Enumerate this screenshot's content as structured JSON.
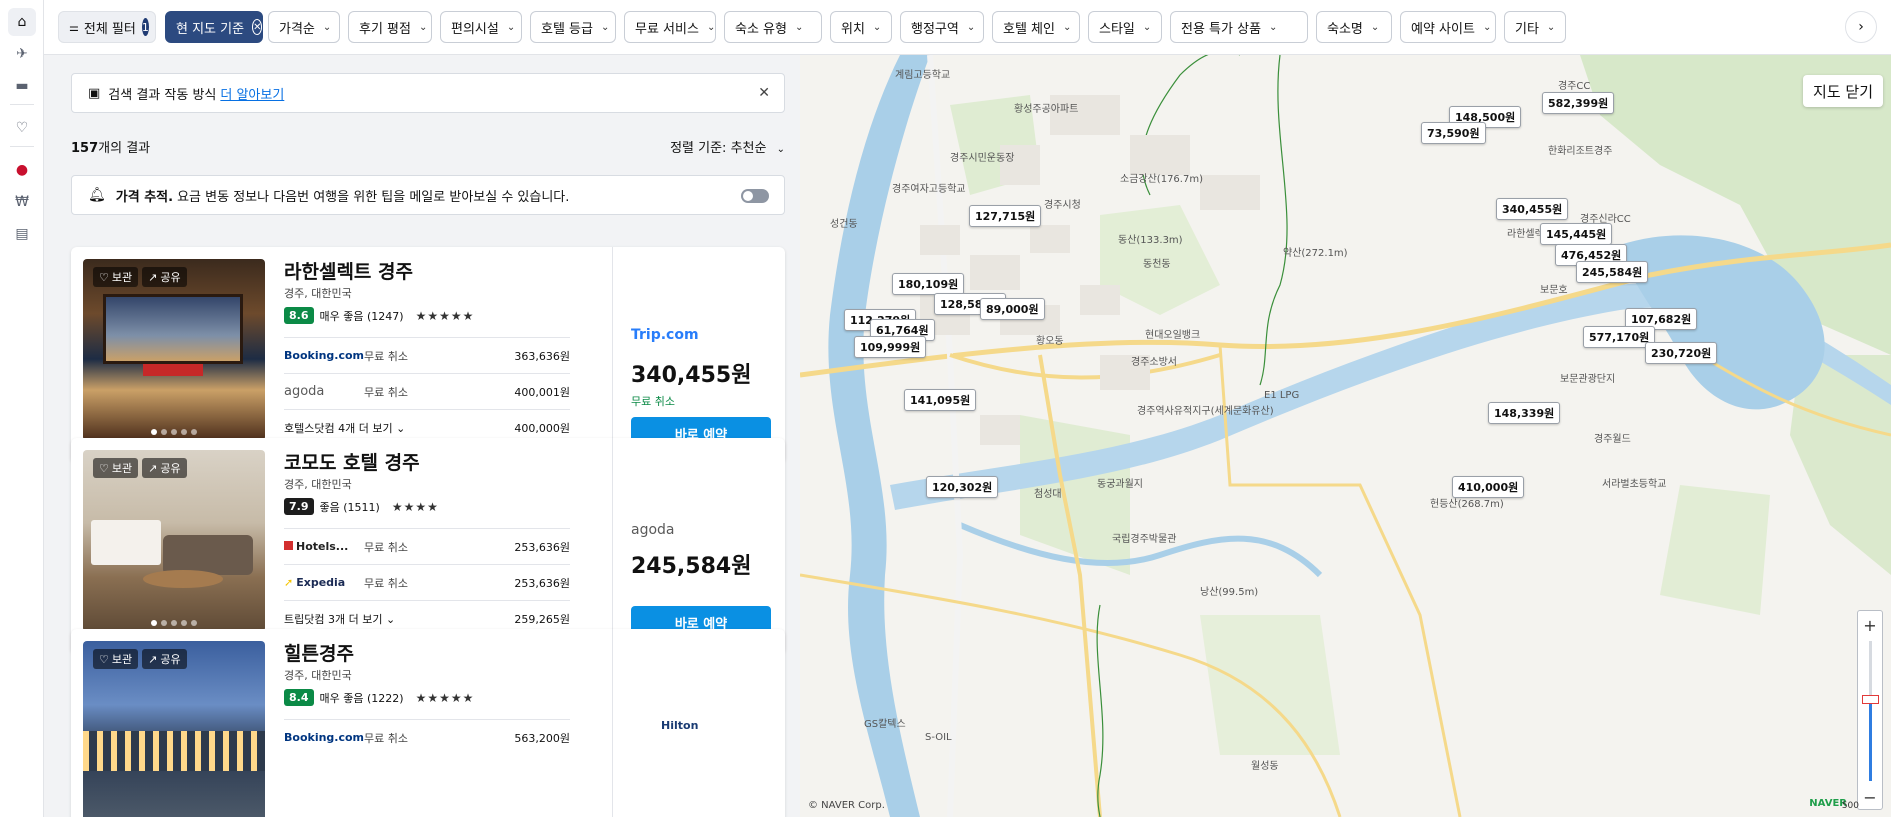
{
  "rail": {
    "items": [
      {
        "icon": "bed-icon",
        "glyph": "⌂"
      },
      {
        "icon": "plane-icon",
        "glyph": "✈"
      },
      {
        "icon": "car-icon",
        "glyph": "▬"
      },
      {
        "icon": "heart-icon",
        "glyph": "♡"
      },
      {
        "icon": "korea-flag-icon",
        "glyph": "●"
      },
      {
        "icon": "won-icon",
        "glyph": "₩"
      },
      {
        "icon": "feedback-icon",
        "glyph": "▤"
      }
    ]
  },
  "filters": {
    "all_label": "전체 필터",
    "all_count": "1",
    "current_label": "현 지도 기준",
    "chips": [
      "가격순",
      "후기 평점",
      "편의시설",
      "호텔 등급",
      "무료 서비스",
      "숙소 유형",
      "위치",
      "행정구역",
      "호텔 체인",
      "스타일",
      "전용 특가 상품",
      "숙소명",
      "예약 사이트",
      "기타"
    ]
  },
  "info": {
    "text": "검색 결과 작동 방식",
    "link": "더 알아보기"
  },
  "results": {
    "count": "157",
    "suffix": "개의 결과",
    "sort_label": "정렬 기준:",
    "sort_value": "추천순"
  },
  "price_tracking": {
    "title": "가격 추적.",
    "text": "요금 변동 정보나 다음번 여행을 위한 팁을 메일로 받아보실 수 있습니다."
  },
  "card_buttons": {
    "save": "보관",
    "share": "공유"
  },
  "hotels": [
    {
      "name": "라한셀렉트 경주",
      "location": "경주, 대한민국",
      "score": "8.6",
      "score_color": "#0b8a46",
      "rating_text": "매우 좋음 (1247)",
      "stars": "★★★★★",
      "offers": [
        {
          "provider": "Booking.com",
          "cancel": "무료 취소",
          "price": "363,636원"
        },
        {
          "provider": "agoda",
          "cancel": "무료 취소",
          "price": "400,001원"
        },
        {
          "provider": "호텔스닷컴 4개 더 보기 ⌄",
          "cancel": "",
          "price": "400,000원"
        }
      ],
      "best_provider": "Trip.com",
      "best_price": "340,455원",
      "best_cancel": "무료 취소",
      "book_label": "바로 예약"
    },
    {
      "name": "코모도 호텔 경주",
      "location": "경주, 대한민국",
      "score": "7.9",
      "score_color": "#1d1d1d",
      "rating_text": "좋음 (1511)",
      "stars": "★★★★",
      "offers": [
        {
          "provider": "Hotels...",
          "cancel": "무료 취소",
          "price": "253,636원"
        },
        {
          "provider": "Expedia",
          "cancel": "무료 취소",
          "price": "253,636원"
        },
        {
          "provider": "트립닷컴 3개 더 보기 ⌄",
          "cancel": "",
          "price": "259,265원"
        }
      ],
      "best_provider": "agoda",
      "best_price": "245,584원",
      "best_cancel": "",
      "book_label": "바로 예약"
    },
    {
      "name": "힐튼경주",
      "location": "경주, 대한민국",
      "score": "8.4",
      "score_color": "#0b8a46",
      "rating_text": "매우 좋음 (1222)",
      "stars": "★★★★★",
      "offers": [
        {
          "provider": "Booking.com",
          "cancel": "무료 취소",
          "price": "563,200원"
        }
      ],
      "best_provider": "Hilton",
      "best_price": "",
      "best_cancel": "",
      "book_label": ""
    }
  ],
  "map": {
    "close_label": "지도 닫기",
    "attribution": "© NAVER Corp.",
    "brand": "NAVER",
    "scale": "500",
    "price_pins": [
      "582,399원",
      "148,500원",
      "73,590원",
      "127,715원",
      "340,455원",
      "145,445원",
      "476,452원",
      "245,584원",
      "180,109원",
      "128,588원",
      "89,000원",
      "112,279원",
      "61,764원",
      "109,999원",
      "107,682원",
      "577,170원",
      "230,720원",
      "141,095원",
      "148,339원",
      "120,302원",
      "410,000원"
    ],
    "place_labels": [
      "경주CC",
      "황성주공아파트",
      "경주시민운동장",
      "경주여자고등학교",
      "경주시청",
      "소금강산(176.7m)",
      "동산(133.3m)",
      "약산(272.1m)",
      "동천동",
      "황오동",
      "현대오일뱅크",
      "경주소방서",
      "E1 LPG",
      "경주역사유적지구(세계문화유산)",
      "동궁과월지",
      "첨성대",
      "국립경주박물관",
      "한화리조트경주",
      "라한셀렉트경주",
      "보문호",
      "경주신라CC",
      "보문관광단지",
      "경주월드",
      "서라벌초등학교",
      "헌등산(268.7m)",
      "낭산(99.5m)",
      "월성동",
      "GS칼텍스",
      "S-OIL",
      "성건동",
      "계림고등학교"
    ]
  }
}
